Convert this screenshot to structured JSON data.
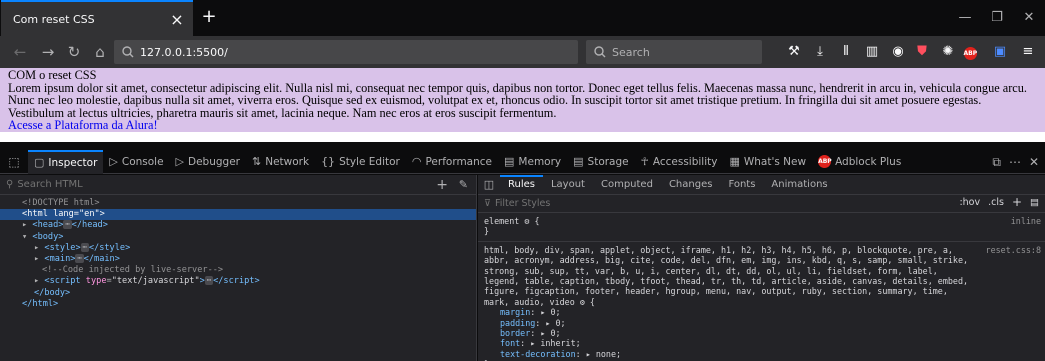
{
  "browser": {
    "tab_title": "Com reset CSS",
    "tab_close": "×",
    "new_tab": "+",
    "url": "127.0.0.1:5500/",
    "search_placeholder": "Search"
  },
  "page": {
    "heading": "COM o reset CSS",
    "paragraph": "Lorem ipsum dolor sit amet, consectetur adipiscing elit. Nulla nisl mi, consequat nec tempor quis, dapibus non tortor. Donec eget tellus felis. Maecenas massa nunc, hendrerit in arcu in, vehicula congue arcu. Nunc nec leo molestie, dapibus nulla sit amet, viverra eros. Quisque sed ex euismod, volutpat ex et, rhoncus odio. In suscipit tortor sit amet tristique pretium. In fringilla dui sit amet posuere egestas. Vestibulum at lectus ultricies, pharetra mauris sit amet, lacinia neque. Nam nec eros at eros suscipit fermentum.",
    "link": "Acesse a Plataforma da Alura!",
    "background": "#d9c2e9"
  },
  "devtools": {
    "tabs": [
      "Inspector",
      "Console",
      "Debugger",
      "Network",
      "Style Editor",
      "Performance",
      "Memory",
      "Storage",
      "Accessibility",
      "What's New",
      "Adblock Plus"
    ],
    "abp_badge": "ABP",
    "markup_search_placeholder": "Search HTML",
    "tree": {
      "doctype": "<!DOCTYPE html>",
      "html_tag": "html",
      "html_attr": "lang",
      "html_val": "\"en\"",
      "head": "head",
      "body": "body",
      "style": "style",
      "main": "main",
      "comment": "<!--Code injected by live-server-->",
      "script": "script",
      "script_attr": "type",
      "script_val": "\"text/javascript\"",
      "body_close": "</body>",
      "html_close": "</html>"
    },
    "side_tabs": [
      "Rules",
      "Layout",
      "Computed",
      "Changes",
      "Fonts",
      "Animations"
    ],
    "filter_placeholder": "Filter Styles",
    "hov": ":hov",
    "cls": ".cls",
    "rules": {
      "element_selector": "element",
      "element_src": "inline",
      "open_brace": "{",
      "close_brace": "}",
      "reset_selector": "html, body, div, span, applet, object, iframe, h1, h2, h3, h4, h5, h6, p, blockquote, pre, a, abbr, acronym, address, big, cite, code, del, dfn, em, img, ins, kbd, q, s, samp, small, strike, strong, sub, sup, tt, var, b, u, i, center, dl, dt, dd, ol, ul, li, fieldset, form, label, legend, table, caption, tbody, tfoot, thead, tr, th, td, article, aside, canvas, details, embed, figure, figcaption, footer, header, hgroup, menu, nav, output, ruby, section, summary, time, mark, audio, video",
      "reset_src": "reset.css:8",
      "props": [
        {
          "name": "margin",
          "value": "0"
        },
        {
          "name": "padding",
          "value": "0"
        },
        {
          "name": "border",
          "value": "0"
        },
        {
          "name": "font",
          "value": "inherit"
        },
        {
          "name": "text-decoration",
          "value": "none"
        }
      ]
    }
  },
  "colors": {
    "accent": "#0a84ff",
    "selected_node": "#204e8a",
    "panel_bg": "#232327"
  }
}
